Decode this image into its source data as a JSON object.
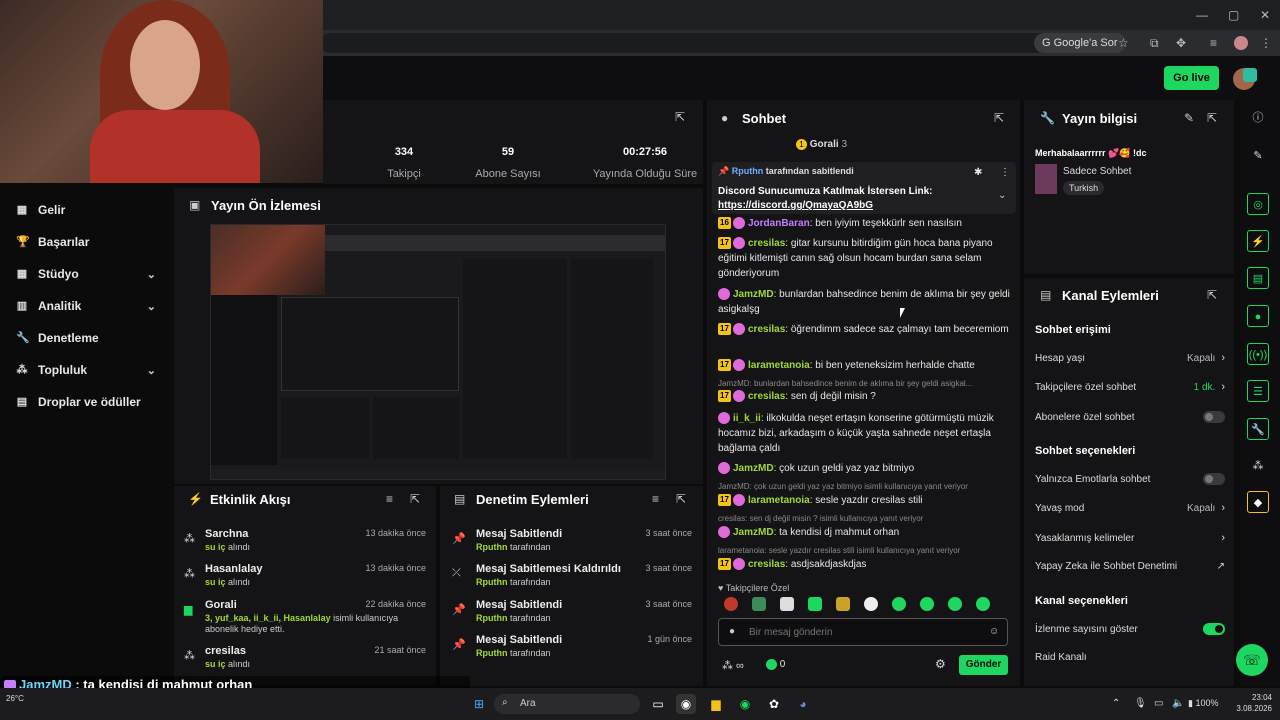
{
  "browser": {
    "google_button": "Google'a Sor"
  },
  "header": {
    "go_live": "Go live"
  },
  "nav": [
    {
      "label": "Gelir",
      "icon": "wallet-icon",
      "chev": false
    },
    {
      "label": "Başarılar",
      "icon": "trophy-icon",
      "chev": false
    },
    {
      "label": "Stüdyo",
      "icon": "studio-icon",
      "chev": true
    },
    {
      "label": "Analitik",
      "icon": "analytics-icon",
      "chev": true
    },
    {
      "label": "Denetleme",
      "icon": "wrench-icon",
      "chev": false
    },
    {
      "label": "Topluluk",
      "icon": "community-icon",
      "chev": true
    },
    {
      "label": "Droplar ve ödüller",
      "icon": "drops-icon",
      "chev": false
    }
  ],
  "stats": [
    {
      "value": "334",
      "label": "Takipçi"
    },
    {
      "value": "59",
      "label": "Abone Sayısı"
    },
    {
      "value": "00:27:56",
      "label": "Yayında Olduğu Süre"
    }
  ],
  "preview": {
    "title": "Yayın Ön İzlemesi"
  },
  "activity": {
    "title": "Etkinlik Akışı",
    "items": [
      {
        "name": "Sarchna",
        "sub": "su iç",
        "sub2": " alındı",
        "time": "13 dakika önce"
      },
      {
        "name": "Hasanlalay",
        "sub": "su iç",
        "sub2": " alındı",
        "time": "13 dakika önce"
      },
      {
        "name": "Gorali",
        "sub": "3, yuf_kaa, ii_k_ii, Hasanlalay",
        "sub2": " isimli kullanıcıya abonelik hediye etti.",
        "time": "22 dakika önce"
      },
      {
        "name": "cresilas",
        "sub": "su iç",
        "sub2": " alındı",
        "time": "21 saat önce"
      }
    ]
  },
  "moderation": {
    "title": "Denetim Eylemleri",
    "items": [
      {
        "name": "Mesaj Sabitlendi",
        "by": "Rputhn",
        "by2": " tarafından",
        "time": "3 saat önce"
      },
      {
        "name": "Mesaj Sabitlemesi Kaldırıldı",
        "by": "Rputhn",
        "by2": " tarafından",
        "time": "3 saat önce"
      },
      {
        "name": "Mesaj Sabitlendi",
        "by": "Rputhn",
        "by2": " tarafından",
        "time": "3 saat önce"
      },
      {
        "name": "Mesaj Sabitlendi",
        "by": "Rputhn",
        "by2": " tarafından",
        "time": "1 gün önce"
      }
    ]
  },
  "chat": {
    "title": "Sohbet",
    "top_user": "Gorali",
    "top_count": "3",
    "pinned_by": "Rputhn",
    "pinned_suffix": " tarafından sabitlendi",
    "pinned_text": "Discord Sunucumuza Katılmak İstersen Link:",
    "pinned_link": "https://discord.gg/QmayaQA9bG",
    "messages": [
      {
        "badge": "16",
        "user": "JordanBaran",
        "color": "#c77dff",
        "text": " ben iyiyim teşekkürlr sen nasılsın"
      },
      {
        "badge": "17",
        "user": "cresilas",
        "color": "#a0d83a",
        "text": " gitar kursunu bitirdiğim gün hoca bana piyano eğitimi kitlemişti canın sağ olsun hocam burdan sana selam gönderiyorum"
      },
      {
        "badge": "",
        "user": "JamzMD",
        "color": "#a0d83a",
        "text": " bunlardan bahsedince benim de aklıma bir şey geldi asigkalşg"
      },
      {
        "badge": "17",
        "user": "cresilas",
        "color": "#a0d83a",
        "text": " öğrendimm sadece saz çalmayı tam beceremiom"
      },
      {
        "badge": "17",
        "user": "larametanoia",
        "color": "#a0d83a",
        "text": " bi ben yeteneksizim herhalde chatte"
      },
      {
        "reply": "JamzMD: bunlardan bahsedince benim de aklıma bir şey geldi asigkal...",
        "badge": "17",
        "user": "cresilas",
        "color": "#a0d83a",
        "text": " sen dj değil misin ?"
      },
      {
        "badge": "",
        "user": "ii_k_ii",
        "color": "#a0d83a",
        "text": " ilkokulda neşet ertaşın konserine götürmüştü müzik hocamız bizi, arkadaşım o küçük yaşta sahnede neşet ertaşla bağlama çaldı"
      },
      {
        "badge": "",
        "user": "JamzMD",
        "color": "#a0d83a",
        "text": " çok uzun geldi yaz yaz bitmiyo"
      },
      {
        "reply": "JamzMD: çok uzun geldi yaz yaz bitmiyo isimli kullanıcıya yanıt veriyor",
        "badge": "17",
        "user": "larametanoia",
        "color": "#a0d83a",
        "text": " sesle yazdır cresilas stili"
      },
      {
        "reply": "cresilas: sen dj değil misin ? isimli kullanıcıya yanıt veriyor",
        "badge": "",
        "user": "JamzMD",
        "color": "#a0d83a",
        "text": " ta kendisi dj mahmut orhan"
      },
      {
        "reply": "larametanoia: sesle yazdır cresilas stili isimli kullanıcıya yanıt veriyor",
        "badge": "17",
        "user": "cresilas",
        "color": "#a0d83a",
        "text": " asdjsakdjaskdjas"
      }
    ],
    "followers_label": "Takipçilere Özel",
    "placeholder": "Bir mesaj gönderin",
    "points": "0",
    "send": "Gönder"
  },
  "stream_info": {
    "title": "Yayın bilgisi",
    "stream_title": "Merhabalaarrrrrr 💕🥰 !dc",
    "category": "Sadece Sohbet",
    "tag": "Turkish"
  },
  "channel_actions": {
    "title": "Kanal Eylemleri",
    "chat_access": "Sohbet erişimi",
    "rows1": [
      {
        "label": "Hesap yaşı",
        "value": "Kapalı",
        "kind": "chev"
      },
      {
        "label": "Takipçilere özel sohbet",
        "value": "1 dk.",
        "kind": "chev"
      },
      {
        "label": "Abonelere özel sohbet",
        "value": "",
        "kind": "toggle-off"
      }
    ],
    "chat_options": "Sohbet seçenekleri",
    "rows2": [
      {
        "label": "Yalnızca Emotlarla sohbet",
        "value": "",
        "kind": "toggle-off"
      },
      {
        "label": "Yavaş mod",
        "value": "Kapalı",
        "kind": "chev"
      },
      {
        "label": "Yasaklanmış kelimeler",
        "value": "",
        "kind": "chev"
      },
      {
        "label": "Yapay Zeka ile Sohbet Denetimi",
        "value": "",
        "kind": "ext"
      }
    ],
    "channel_options": "Kanal seçenekleri",
    "rows3": [
      {
        "label": "İzlenme sayısını göster",
        "value": "",
        "kind": "toggle-on"
      },
      {
        "label": "Raid Kanalı",
        "value": "",
        "kind": "none"
      }
    ]
  },
  "overlay": [
    {
      "user": "JamzMD",
      "text": " : ta kendisi dj mahmut orhan"
    },
    {
      "user": "cresilas",
      "text": " : asdjsakdjaskdjas"
    }
  ],
  "taskbar": {
    "search": "Ara",
    "time": "23:04",
    "date": "3.08.2026",
    "battery": "100%",
    "weather": "26°C"
  },
  "colors": {
    "accent": "#1ed760",
    "sub": "#a0d83a",
    "bg": "#0b0b0b",
    "panel": "#141416"
  }
}
